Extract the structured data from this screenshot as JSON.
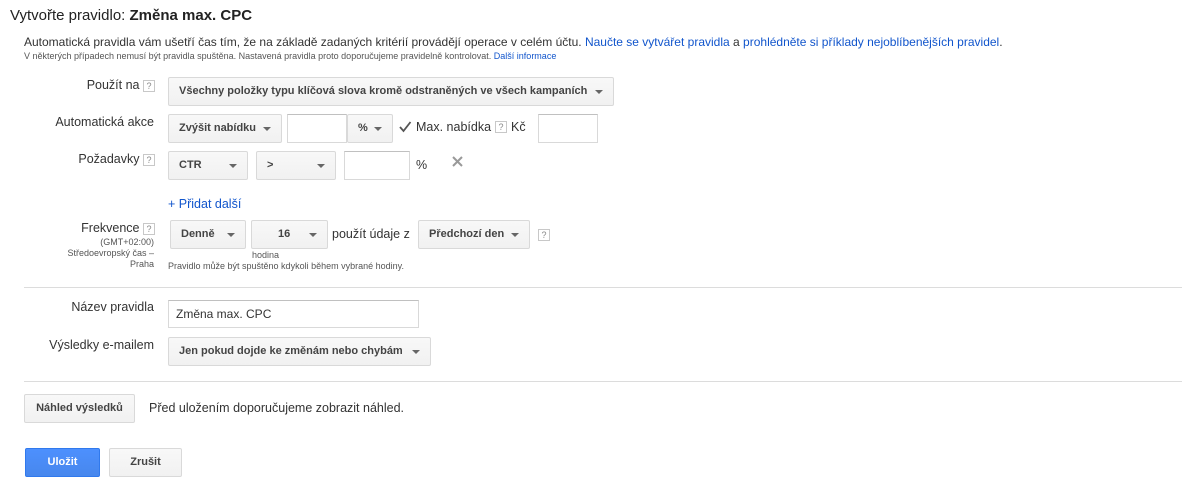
{
  "header": {
    "title_prefix": "Vytvořte pravidlo:",
    "title_name": "Změna max. CPC"
  },
  "intro": {
    "text": "Automatická pravidla vám ušetří čas tím, že na základě zadaných kritérií provádějí operace v celém účtu.",
    "link1": "Naučte se vytvářet pravidla",
    "connector": "a",
    "link2": "prohlédněte si příklady nejoblíbenějších pravidel",
    "end": ".",
    "note": "V některých případech nemusí být pravidla spuštěna. Nastavená pravidla proto doporučujeme pravidelně kontrolovat.",
    "note_link": "Další informace"
  },
  "apply_on": {
    "label": "Použít na",
    "help": "?",
    "value": "Všechny položky typu klíčová slova kromě odstraněných ve všech kampaních"
  },
  "action": {
    "label": "Automatická akce",
    "type": "Zvýšit nabídku",
    "amount": "",
    "unit": "%",
    "max_checked": true,
    "max_label": "Max. nabídka",
    "help": "?",
    "currency": "Kč",
    "max_value": ""
  },
  "requirements": {
    "label": "Požadavky",
    "help": "?",
    "metric": "CTR",
    "operator": ">",
    "value": "",
    "unit": "%",
    "add_more": "+ Přidat další"
  },
  "frequency": {
    "label": "Frekvence",
    "help": "?",
    "tz1": "(GMT+02:00)",
    "tz2": "Středoevropský čas –",
    "tz3": "Praha",
    "period": "Denně",
    "hour": "16",
    "hour_label": "hodina",
    "use_data_text": "použít údaje z",
    "data_range": "Předchozí den",
    "help2": "?",
    "note": "Pravidlo může být spuštěno kdykoli během vybrané hodiny."
  },
  "rule_name": {
    "label": "Název pravidla",
    "value": "Změna max. CPC"
  },
  "email": {
    "label": "Výsledky e-mailem",
    "value": "Jen pokud dojde ke změnám nebo chybám"
  },
  "preview": {
    "button": "Náhled výsledků",
    "text": "Před uložením doporučujeme zobrazit náhled."
  },
  "footer": {
    "save": "Uložit",
    "cancel": "Zrušit"
  },
  "colors": {
    "link": "#1155cc",
    "primary": "#4d90fe"
  }
}
